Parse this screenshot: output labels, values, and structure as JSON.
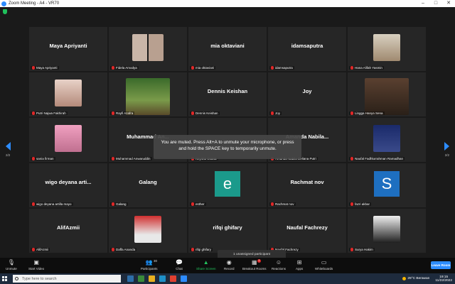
{
  "window": {
    "title": "Zoom Meeting - A4 - VR70",
    "controls": [
      "–",
      "□",
      "✕"
    ]
  },
  "colors": {
    "accent": "#2d8cff",
    "muted_mic": "#e02828",
    "share_green": "#22c55e",
    "tile_bg": "#262626"
  },
  "pagination": {
    "left": "2/2",
    "right": "2/2"
  },
  "tiles": [
    {
      "label": "Maya Apriyanti",
      "display": "Maya Apriyanti"
    },
    {
      "label": "Fidela Amodya",
      "display": ""
    },
    {
      "label": "mia oktaviani",
      "display": "mia oktaviani"
    },
    {
      "label": "idamsaputra",
      "display": "idamsaputra"
    },
    {
      "label": "Hana Alifah Yasmin",
      "display": ""
    },
    {
      "label": "Putri Najwa Fakhirah",
      "display": ""
    },
    {
      "label": "Rayfi Azafra",
      "display": ""
    },
    {
      "label": "Dennis Keishan",
      "display": "Dennis Keishan"
    },
    {
      "label": "Joy",
      "display": "Joy"
    },
    {
      "label": "Lingga Hanya Sena",
      "display": ""
    },
    {
      "label": "sania firman",
      "display": ""
    },
    {
      "label": "Muhammad Anwaruddin",
      "display": "Muhammad An..."
    },
    {
      "label": "Keysha Oxana",
      "display": ""
    },
    {
      "label": "Amanda Nabila Deliana Putri",
      "display": "Amanda Nabila..."
    },
    {
      "label": "Naufal Fadhlurrahman Ramadhan",
      "display": ""
    },
    {
      "label": "wigo deyana artilla mayo",
      "display": "wigo deyana arti..."
    },
    {
      "label": "Galang",
      "display": "Galang"
    },
    {
      "label": "esther",
      "display": ""
    },
    {
      "label": "Rachmat nov",
      "display": "Rachmat nov"
    },
    {
      "label": "fazri akbar",
      "display": ""
    },
    {
      "label": "AlifAzmii",
      "display": "AlifAzmii"
    },
    {
      "label": "Daffa Ananda",
      "display": ""
    },
    {
      "label": "rifqi ghifary",
      "display": "rifqi ghifary"
    },
    {
      "label": "Naufal Fachrezy",
      "display": "Naufal Fachrezy"
    },
    {
      "label": "Surya Hakim",
      "display": ""
    }
  ],
  "avatars": {
    "esther": {
      "letter": "e",
      "color": "#1b9a8b"
    },
    "fazri": {
      "letter": "S",
      "color": "#1e6fc0"
    }
  },
  "toast": "You are muted. Press Alt+A to unmute your microphone, or press and hold the SPACE key to temporarily unmute.",
  "unassigned": "1 unassigned participant",
  "toolbar": {
    "unmute": "Unmute",
    "start_video": "Start Video",
    "participants": "Participants",
    "participants_count": "30",
    "chat": "Chat",
    "share_screen": "Share Screen",
    "record": "Record",
    "breakout_rooms": "Breakout Rooms",
    "breakout_badge": "1",
    "reactions": "Reactions",
    "apps": "Apps",
    "whiteboards": "Whiteboards",
    "leave": "Leave Room"
  },
  "taskbar": {
    "search_placeholder": "Type here to search",
    "weather": "29°C Berawan",
    "time": "19:15",
    "date": "11/22/2022"
  }
}
